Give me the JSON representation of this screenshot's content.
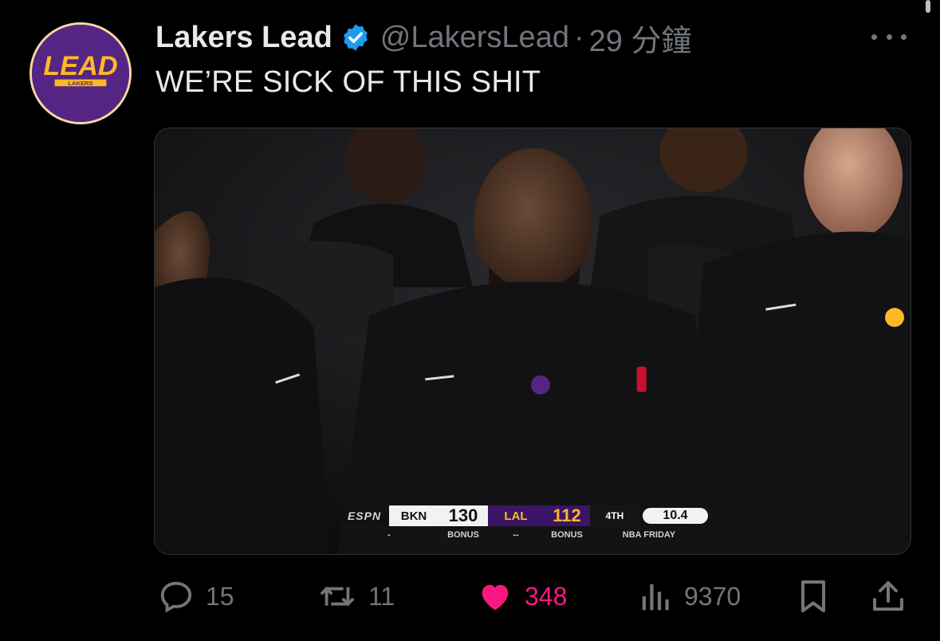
{
  "tweet": {
    "author_name": "Lakers Lead",
    "handle": "@LakersLead",
    "separator": "·",
    "time": "29 分鐘",
    "text": "WE’RE SICK OF THIS SHIT",
    "avatar": {
      "logo_text": "LEAD",
      "sub_text": "LAKERS"
    }
  },
  "media": {
    "scoreboard": {
      "network": "ESPN",
      "home_team": "BKN",
      "home_score": "130",
      "away_team": "LAL",
      "away_score": "112",
      "period": "4TH",
      "clock": "10.4",
      "bonus_left": "BONUS",
      "bonus_right": "BONUS",
      "dash_left": "-",
      "dash_mid": "--",
      "tagline": "NBA  FRIDAY"
    }
  },
  "actions": {
    "reply": {
      "count": "15",
      "icon": "reply-icon"
    },
    "retweet": {
      "count": "11",
      "icon": "retweet-icon"
    },
    "like": {
      "count": "348",
      "icon": "heart-icon",
      "liked": true
    },
    "views": {
      "count": "9370",
      "icon": "views-icon"
    },
    "bookmark": {
      "icon": "bookmark-icon"
    },
    "share": {
      "icon": "share-icon"
    }
  },
  "colors": {
    "background": "#000000",
    "text": "#e7e9ea",
    "muted": "#71767b",
    "verified": "#1d9bf0",
    "like": "#f91880",
    "lakers_purple": "#552583",
    "lakers_gold": "#fdb927"
  }
}
